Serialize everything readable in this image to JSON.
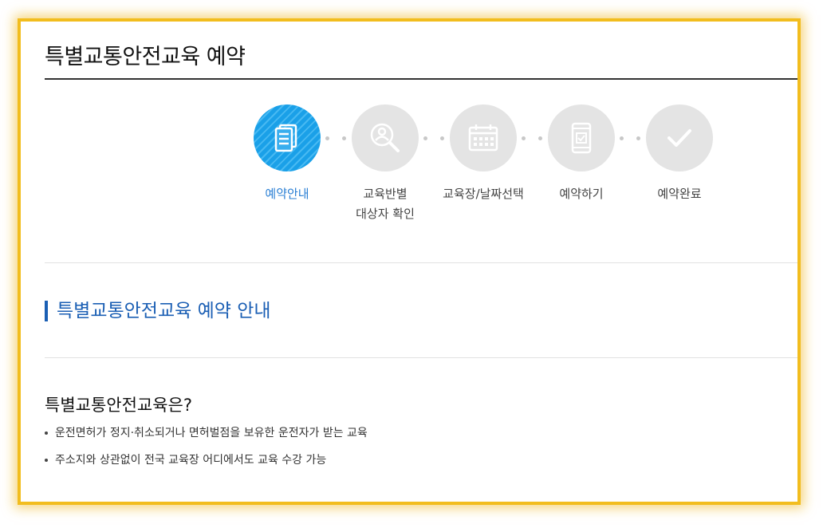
{
  "page": {
    "title": "특별교통안전교육 예약"
  },
  "steps": [
    {
      "label": "예약안내",
      "icon": "document-icon",
      "active": true
    },
    {
      "label": "교육반별",
      "label2": "대상자 확인",
      "icon": "search-user-icon",
      "active": false
    },
    {
      "label": "교육장/날짜선택",
      "icon": "calendar-icon",
      "active": false
    },
    {
      "label": "예약하기",
      "icon": "mobile-check-icon",
      "active": false
    },
    {
      "label": "예약완료",
      "icon": "checkmark-icon",
      "active": false
    }
  ],
  "section": {
    "title": "특별교통안전교육 예약 안내"
  },
  "info": {
    "heading": "특별교통안전교육은?",
    "bullets": [
      "운전면허가 정지·취소되거나 면허벌점을 보유한 운전자가 받는 교육",
      "주소지와 상관없이 전국 교육장 어디에서도 교육 수강 가능"
    ]
  },
  "colors": {
    "frame": "#f2bd1e",
    "accent": "#1b5fb4",
    "active_step": "#1aa0e8",
    "inactive_step": "#e4e4e4"
  }
}
